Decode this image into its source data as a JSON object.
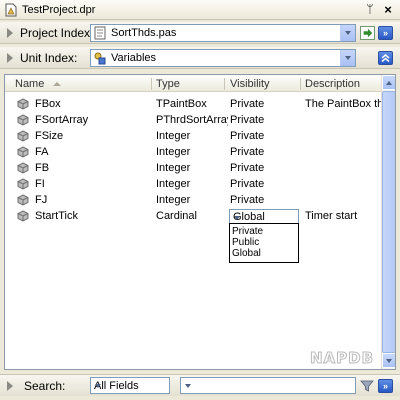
{
  "window": {
    "title": "TestProject.dpr",
    "pin_glyph": "ᛘ",
    "close_glyph": "×"
  },
  "project_index": {
    "label": "Project Index:",
    "value": "SortThds.pas",
    "icon": "pas-file-icon"
  },
  "unit_index": {
    "label": "Unit Index:",
    "value": "Variables",
    "icon": "variables-icon"
  },
  "table": {
    "columns": [
      "Name",
      "Type",
      "Visibility",
      "Description"
    ],
    "rows": [
      {
        "name": "FBox",
        "type": "TPaintBox",
        "visibility": "Private",
        "description": "The PaintBox th..."
      },
      {
        "name": "FSortArray",
        "type": "PThrdSortArray",
        "visibility": "Private",
        "description": ""
      },
      {
        "name": "FSize",
        "type": "Integer",
        "visibility": "Private",
        "description": ""
      },
      {
        "name": "FA",
        "type": "Integer",
        "visibility": "Private",
        "description": ""
      },
      {
        "name": "FB",
        "type": "Integer",
        "visibility": "Private",
        "description": ""
      },
      {
        "name": "FI",
        "type": "Integer",
        "visibility": "Private",
        "description": ""
      },
      {
        "name": "FJ",
        "type": "Integer",
        "visibility": "Private",
        "description": ""
      },
      {
        "name": "StartTick",
        "type": "Cardinal",
        "visibility": "Global",
        "description": "Timer start"
      }
    ],
    "visibility_options": [
      "Private",
      "Public",
      "Global"
    ]
  },
  "watermark": "NAPDB",
  "search": {
    "label": "Search:",
    "field": "All Fields",
    "value": "",
    "placeholder": ""
  },
  "buttons": {
    "chevron_glyph": "»"
  },
  "colors": {
    "accent_blue": "#2858c4",
    "go_green": "#2e8b2e",
    "row_icon": "#7a7a7a"
  }
}
